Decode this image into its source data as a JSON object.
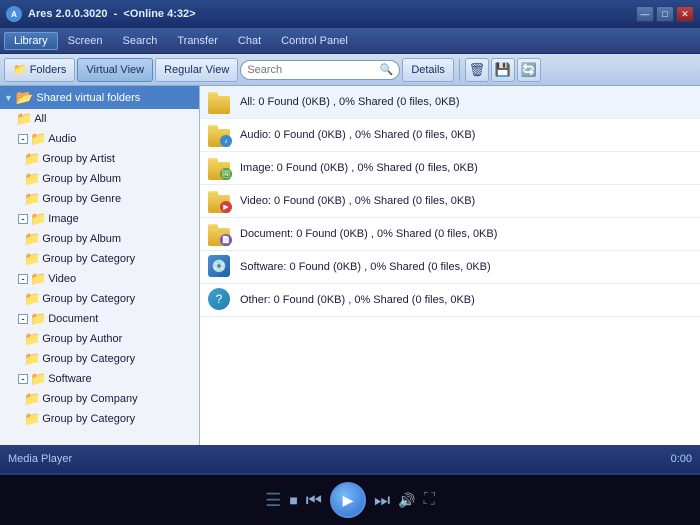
{
  "titleBar": {
    "appName": "Ares 2.0.0.3020",
    "status": "<Online 4:32>",
    "minimizeLabel": "—",
    "maximizeLabel": "□",
    "closeLabel": "✕"
  },
  "menuBar": {
    "items": [
      {
        "id": "library",
        "label": "Library",
        "active": true
      },
      {
        "id": "screen",
        "label": "Screen"
      },
      {
        "id": "search",
        "label": "Search"
      },
      {
        "id": "transfer",
        "label": "Transfer"
      },
      {
        "id": "chat",
        "label": "Chat"
      },
      {
        "id": "controlpanel",
        "label": "Control Panel"
      }
    ]
  },
  "toolbar": {
    "foldersLabel": "Folders",
    "virtualViewLabel": "Virtual View",
    "regularViewLabel": "Regular View",
    "searchPlaceholder": "Search",
    "detailsLabel": "Details"
  },
  "treeView": {
    "rootLabel": "Shared virtual folders",
    "sections": [
      {
        "id": "all",
        "label": "All",
        "isLeaf": true,
        "indent": 1
      },
      {
        "id": "audio",
        "label": "Audio",
        "expanded": true,
        "children": [
          {
            "id": "audio-artist",
            "label": "Group by Artist"
          },
          {
            "id": "audio-album",
            "label": "Group by Album"
          },
          {
            "id": "audio-genre",
            "label": "Group by Genre"
          }
        ]
      },
      {
        "id": "image",
        "label": "Image",
        "expanded": true,
        "children": [
          {
            "id": "image-album",
            "label": "Group by Album"
          },
          {
            "id": "image-category",
            "label": "Group by Category"
          }
        ]
      },
      {
        "id": "video",
        "label": "Video",
        "expanded": true,
        "children": [
          {
            "id": "video-category",
            "label": "Group by Category"
          }
        ]
      },
      {
        "id": "document",
        "label": "Document",
        "expanded": true,
        "children": [
          {
            "id": "doc-author",
            "label": "Group by Author"
          },
          {
            "id": "doc-category",
            "label": "Group by Category"
          }
        ]
      },
      {
        "id": "software",
        "label": "Software",
        "expanded": true,
        "children": [
          {
            "id": "soft-company",
            "label": "Group by Company"
          },
          {
            "id": "soft-category",
            "label": "Group by Category"
          }
        ]
      }
    ]
  },
  "fileList": {
    "items": [
      {
        "id": "all",
        "label": "All: 0 Found (0KB) , 0% Shared (0 files, 0KB)",
        "iconType": "all"
      },
      {
        "id": "audio",
        "label": "Audio: 0 Found (0KB) , 0% Shared (0 files, 0KB)",
        "iconType": "audio"
      },
      {
        "id": "image",
        "label": "Image: 0 Found (0KB) , 0% Shared (0 files, 0KB)",
        "iconType": "image"
      },
      {
        "id": "video",
        "label": "Video: 0 Found (0KB) , 0% Shared (0 files, 0KB)",
        "iconType": "video"
      },
      {
        "id": "document",
        "label": "Document: 0 Found (0KB) , 0% Shared (0 files, 0KB)",
        "iconType": "document"
      },
      {
        "id": "software",
        "label": "Software: 0 Found (0KB) , 0% Shared (0 files, 0KB)",
        "iconType": "software"
      },
      {
        "id": "other",
        "label": "Other: 0 Found (0KB) , 0% Shared (0 files, 0KB)",
        "iconType": "other"
      }
    ]
  },
  "statusBar": {
    "leftText": "Media Player",
    "rightText": "0:00"
  },
  "mediaPlayer": {
    "playlistIcon": "☰",
    "stopIcon": "■",
    "prevIcon": "⏮",
    "playIcon": "▶",
    "nextIcon": "⏭",
    "volumeIcon": "🔊",
    "screenIcon": "⛶"
  }
}
